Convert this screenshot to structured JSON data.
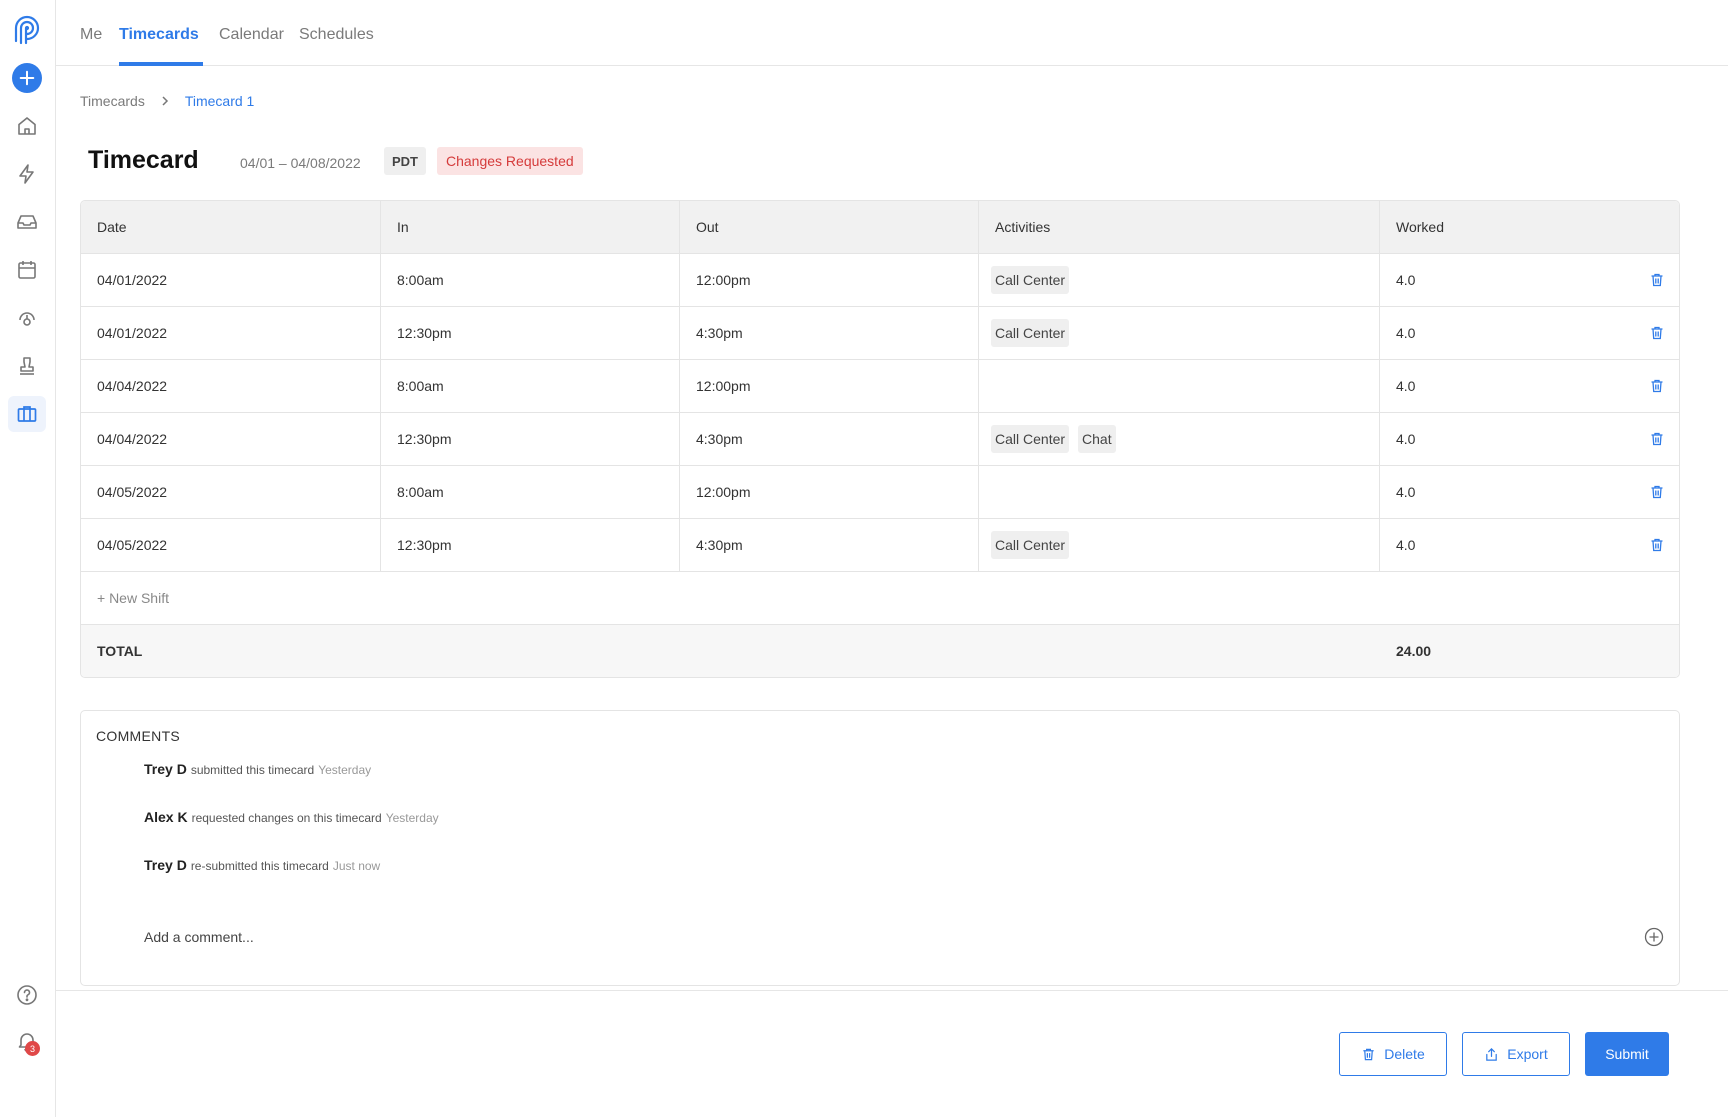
{
  "nav": {
    "tabs": [
      {
        "label": "Me"
      },
      {
        "label": "Timecards"
      },
      {
        "label": "Calendar"
      },
      {
        "label": "Schedules"
      }
    ],
    "active_tab": "Timecards"
  },
  "sidebar": {
    "items": [
      "home-icon",
      "bolt-icon",
      "inbox-icon",
      "calendar-icon",
      "location-pin-icon",
      "stamp-icon",
      "briefcase-icon"
    ],
    "active_item": "briefcase-icon",
    "notification_count": "3"
  },
  "breadcrumb": {
    "parent": "Timecards",
    "current": "Timecard 1"
  },
  "header": {
    "title": "Timecard",
    "date_range": "04/01 – 04/08/2022",
    "timezone": "PDT",
    "status": "Changes Requested"
  },
  "table": {
    "columns": [
      "Date",
      "In",
      "Out",
      "Activities",
      "Worked"
    ],
    "rows": [
      {
        "date": "04/01/2022",
        "in": "8:00am",
        "out": "12:00pm",
        "activities": [
          "Call Center"
        ],
        "worked": "4.0"
      },
      {
        "date": "04/01/2022",
        "in": "12:30pm",
        "out": "4:30pm",
        "activities": [
          "Call Center"
        ],
        "worked": "4.0"
      },
      {
        "date": "04/04/2022",
        "in": "8:00am",
        "out": "12:00pm",
        "activities": [],
        "worked": "4.0"
      },
      {
        "date": "04/04/2022",
        "in": "12:30pm",
        "out": "4:30pm",
        "activities": [
          "Call Center",
          "Chat"
        ],
        "worked": "4.0"
      },
      {
        "date": "04/05/2022",
        "in": "8:00am",
        "out": "12:00pm",
        "activities": [],
        "worked": "4.0"
      },
      {
        "date": "04/05/2022",
        "in": "12:30pm",
        "out": "4:30pm",
        "activities": [
          "Call Center"
        ],
        "worked": "4.0"
      }
    ],
    "new_shift_label": "+ New Shift",
    "total_label": "TOTAL",
    "total_value": "24.00"
  },
  "comments": {
    "title": "COMMENTS",
    "items": [
      {
        "author": "Trey D",
        "action": "submitted this timecard",
        "time": "Yesterday"
      },
      {
        "author": "Alex K",
        "action": "requested changes on this timecard",
        "time": "Yesterday"
      },
      {
        "author": "Trey D",
        "action": "re-submitted this timecard",
        "time": "Just now"
      }
    ],
    "input_placeholder": "Add a comment..."
  },
  "footer": {
    "delete_label": "Delete",
    "export_label": "Export",
    "submit_label": "Submit"
  },
  "colors": {
    "accent": "#2f7be8",
    "status_bg": "#fbe3e3",
    "status_text": "#d53b3b"
  }
}
